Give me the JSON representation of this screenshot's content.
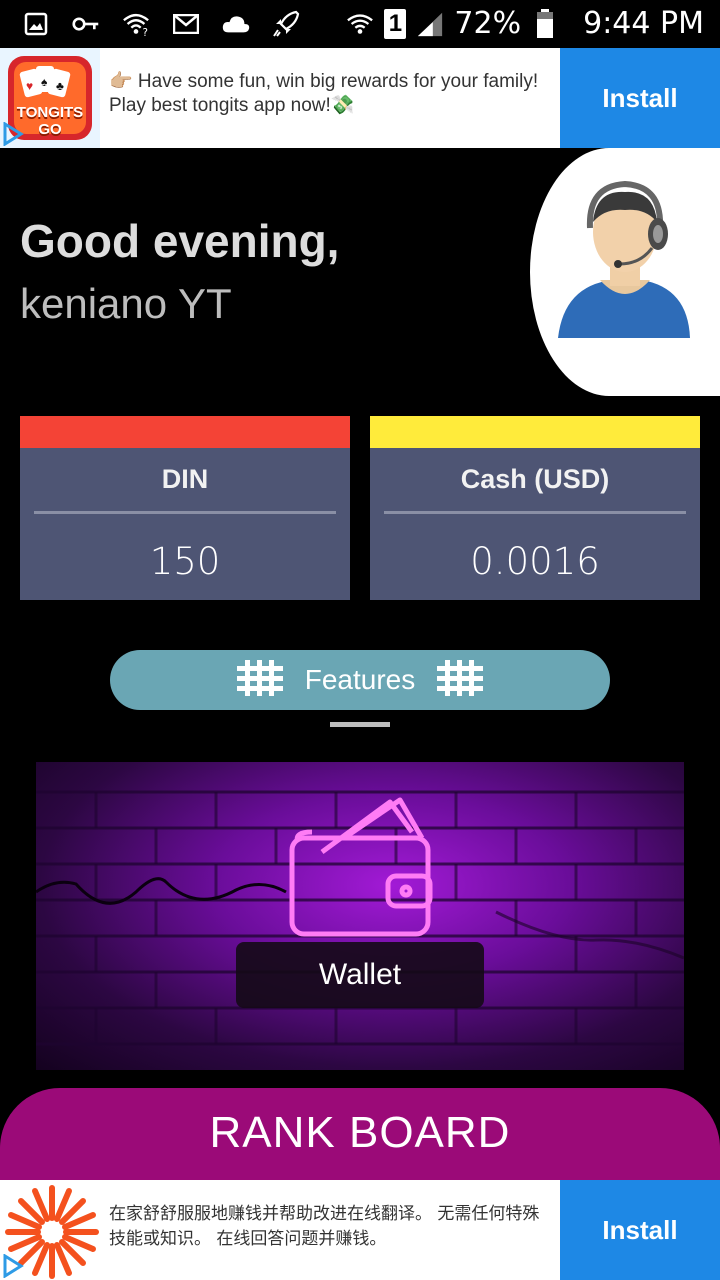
{
  "status_bar": {
    "battery": "72%",
    "time": "9:44 PM",
    "sim": "1",
    "icons": [
      "image-icon",
      "key-icon",
      "wifi-question-icon",
      "mail-icon",
      "cloud-icon",
      "rocket-icon",
      "wifi-icon",
      "signal-icon",
      "battery-icon"
    ]
  },
  "ad_top": {
    "text": "👉🏼 Have some fun, win big rewards for your family! Play best tongits app now!💸",
    "button": "Install",
    "app_logo": "TONGITS GO"
  },
  "greeting": {
    "title": "Good evening,",
    "user": "keniano YT"
  },
  "stats": {
    "din": {
      "title": "DIN",
      "value": "150",
      "color": "#f44336"
    },
    "cash": {
      "title": "Cash (USD)",
      "value": "0.0016",
      "color": "#ffeb3b"
    }
  },
  "features": {
    "label": "Features",
    "icon": "grid-icon"
  },
  "wallet": {
    "label": "Wallet",
    "icon": "neon-wallet-icon"
  },
  "rank_board": {
    "label": "RANK BOARD"
  },
  "ad_bottom": {
    "text": "在家舒舒服服地赚钱并帮助改进在线翻译。 无需任何特殊技能或知识。 在线回答问题并赚钱。",
    "button": "Install"
  }
}
